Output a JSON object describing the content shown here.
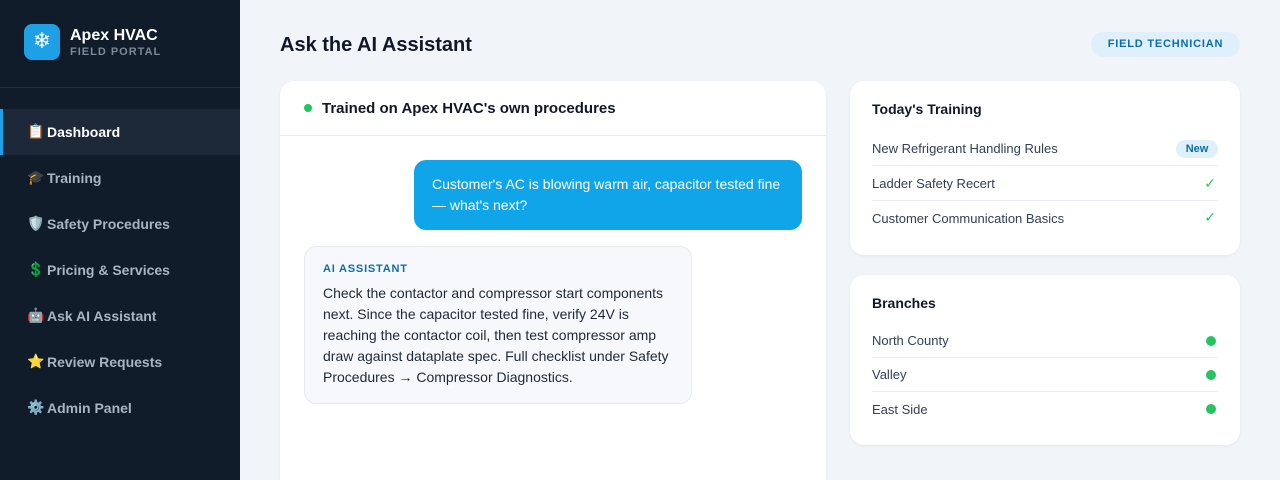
{
  "brand": {
    "logo_glyph": "❄",
    "name": "Apex HVAC",
    "subtitle": "FIELD PORTAL"
  },
  "nav": [
    {
      "icon": "📋",
      "icon_name": "clipboard-icon",
      "label": "Dashboard",
      "active": true
    },
    {
      "icon": "🎓",
      "icon_name": "graduation-cap-icon",
      "label": "Training",
      "active": false
    },
    {
      "icon": "🛡️",
      "icon_name": "shield-icon",
      "label": "Safety Procedures",
      "active": false
    },
    {
      "icon": "💲",
      "icon_name": "dollar-icon",
      "label": "Pricing & Services",
      "active": false
    },
    {
      "icon": "🤖",
      "icon_name": "robot-icon",
      "label": "Ask AI Assistant",
      "active": false
    },
    {
      "icon": "⭐",
      "icon_name": "star-icon",
      "label": "Review Requests",
      "active": false
    },
    {
      "icon": "⚙️",
      "icon_name": "gear-icon",
      "label": "Admin Panel",
      "active": false
    }
  ],
  "header": {
    "title": "Ask the AI Assistant",
    "role_badge": "FIELD TECHNICIAN"
  },
  "chat": {
    "title": "Trained on Apex HVAC's own procedures",
    "user_message": "Customer's AC is blowing warm air, capacitor tested fine — what's next?",
    "ai_label": "AI ASSISTANT",
    "ai_message": "Check the contactor and compressor start components next. Since the capacitor tested fine, verify 24V is reaching the contactor coil, then test compressor amp draw against dataplate spec. Full checklist under Safety Procedures → Compressor Diagnostics."
  },
  "training": {
    "title": "Today's Training",
    "items": [
      {
        "label": "New Refrigerant Handling Rules",
        "badge": "New"
      },
      {
        "label": "Ladder Safety Recert",
        "check": "✓"
      },
      {
        "label": "Customer Communication Basics",
        "check": "✓"
      }
    ]
  },
  "branches": {
    "title": "Branches",
    "items": [
      {
        "label": "North County",
        "status": "online"
      },
      {
        "label": "Valley",
        "status": "online"
      },
      {
        "label": "East Side",
        "status": "online"
      }
    ]
  },
  "colors": {
    "accent": "#1ea0e6",
    "online": "#22c55e",
    "sidebar": "#111c2b"
  }
}
